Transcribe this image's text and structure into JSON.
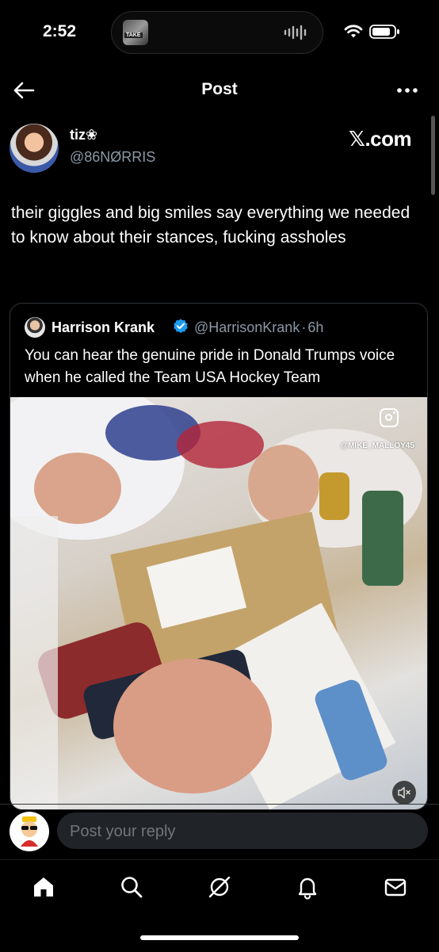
{
  "status_bar": {
    "time": "2:52",
    "island_thumb_label": "TAKE"
  },
  "header": {
    "back_icon": "arrow-left-icon",
    "title": "Post",
    "more_icon": "more-horizontal-icon"
  },
  "post": {
    "author_name": "tiz❀",
    "author_handle": "@86NØRRIS",
    "source_label": "𝕏.com",
    "text": "their giggles and big smiles say everything we needed to know about their stances, fucking assholes"
  },
  "quote": {
    "author_name": "Harrison Krank",
    "verified": true,
    "author_handle": "@HarrisonKrank",
    "separator": "·",
    "time": "6h",
    "text": "You can hear the genuine pride in Donald Trumps voice when he called the Team USA Hockey Team",
    "video": {
      "watermark": "@MIKE_MALLOY45",
      "instagram_icon": "instagram-icon",
      "mute_icon": "muted-speaker-icon"
    }
  },
  "reply": {
    "placeholder": "Post your reply"
  },
  "tabs": [
    {
      "icon": "home-icon",
      "active": true
    },
    {
      "icon": "search-icon",
      "active": false
    },
    {
      "icon": "grok-icon",
      "active": false
    },
    {
      "icon": "bell-icon",
      "active": false
    },
    {
      "icon": "mail-icon",
      "active": false
    }
  ],
  "colors": {
    "background": "#000000",
    "secondary_text": "#8b98a5",
    "verified_blue": "#1d9bf0",
    "input_bg": "#202327"
  }
}
